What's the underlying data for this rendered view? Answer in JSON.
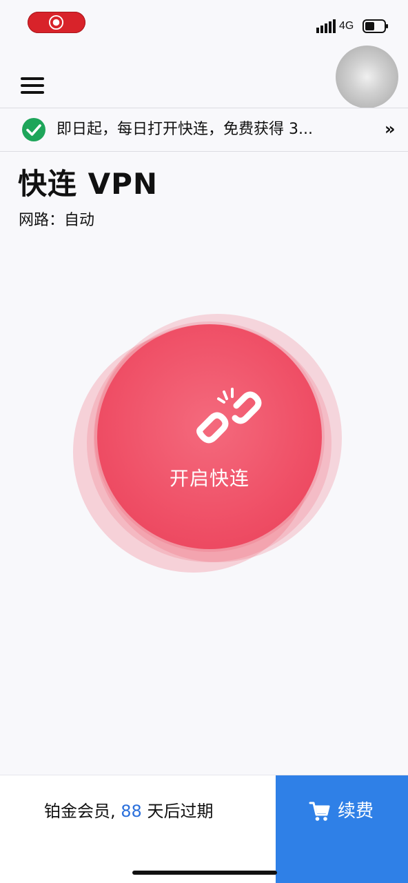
{
  "status_bar": {
    "network": "4G",
    "icons": [
      "screen-record-icon",
      "signal-icon",
      "battery-icon"
    ]
  },
  "header": {
    "icons": [
      "menu-icon",
      "avatar"
    ]
  },
  "notice": {
    "text": "即日起，每日打开快连，免费获得 3...",
    "chevron": "»",
    "icon": "check-circle-icon",
    "icon_color": "#1ea55a"
  },
  "main": {
    "title": "快连 VPN",
    "route_label": "网路：",
    "route_value": "自动",
    "connect_label": "开启快连",
    "connect_color": "#ef4f66",
    "connect_icon": "broken-link-icon"
  },
  "footer": {
    "membership_prefix": "铂金会员, ",
    "days": "88",
    "membership_suffix": " 天后过期",
    "renew_label": "续费",
    "renew_icon": "cart-icon",
    "renew_color": "#2f80e7",
    "days_color": "#2a6fdb"
  }
}
